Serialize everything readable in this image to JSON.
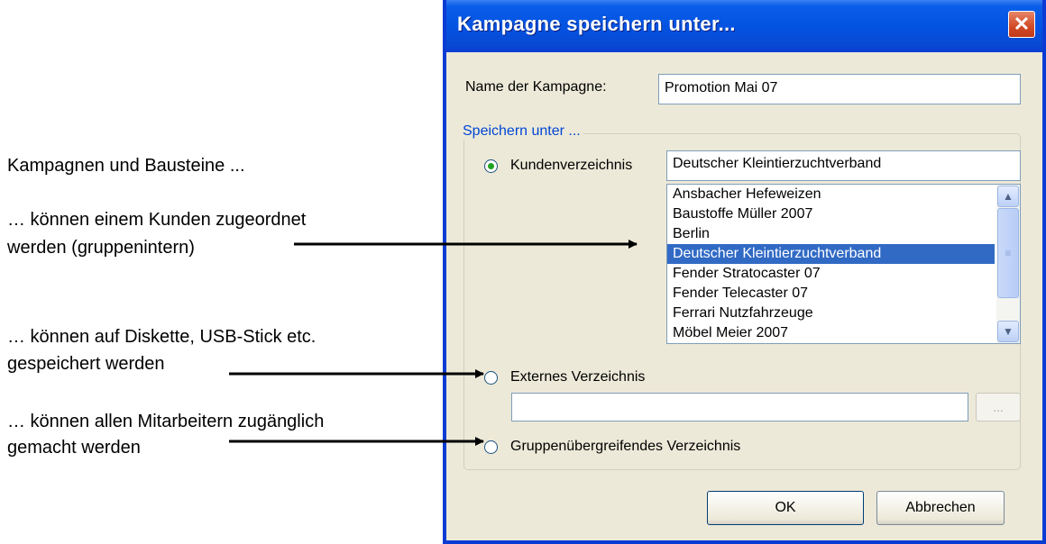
{
  "annotations": {
    "intro": "Kampagnen und Bausteine ...",
    "customer_line1": "… können einem Kunden zugeordnet",
    "customer_line2": "werden (gruppenintern)",
    "disk_line1": "… können auf Diskette, USB-Stick etc.",
    "disk_line2": "gespeichert werden",
    "all_line1": "… können allen Mitarbeitern zugänglich",
    "all_line2": "gemacht werden"
  },
  "dialog": {
    "title": "Kampagne speichern unter...",
    "close_glyph": "✕",
    "name_label": "Name der Kampagne:",
    "name_value": "Promotion Mai 07",
    "group_label": "Speichern unter ...",
    "options": {
      "customer_label": "Kundenverzeichnis",
      "customer_selected": "Deutscher Kleintierzuchtverband",
      "external_label": "Externes Verzeichnis",
      "external_value": "",
      "browse_label": "...",
      "group_label": "Gruppenübergreifendes Verzeichnis",
      "checked": "Kundenverzeichnis"
    },
    "customer_list": [
      "Ansbacher Hefeweizen",
      "Baustoffe Müller 2007",
      "Berlin",
      "Deutscher Kleintierzuchtverband",
      "Fender Stratocaster 07",
      "Fender Telecaster 07",
      "Ferrari Nutzfahrzeuge",
      "Möbel Meier 2007"
    ],
    "selected_index": 3,
    "ok_label": "OK",
    "cancel_label": "Abbrechen"
  },
  "colors": {
    "titlebar": "#0453e2",
    "selection": "#316ac5",
    "dialog_bg": "#ece9d8",
    "group_title": "#0046d5"
  }
}
